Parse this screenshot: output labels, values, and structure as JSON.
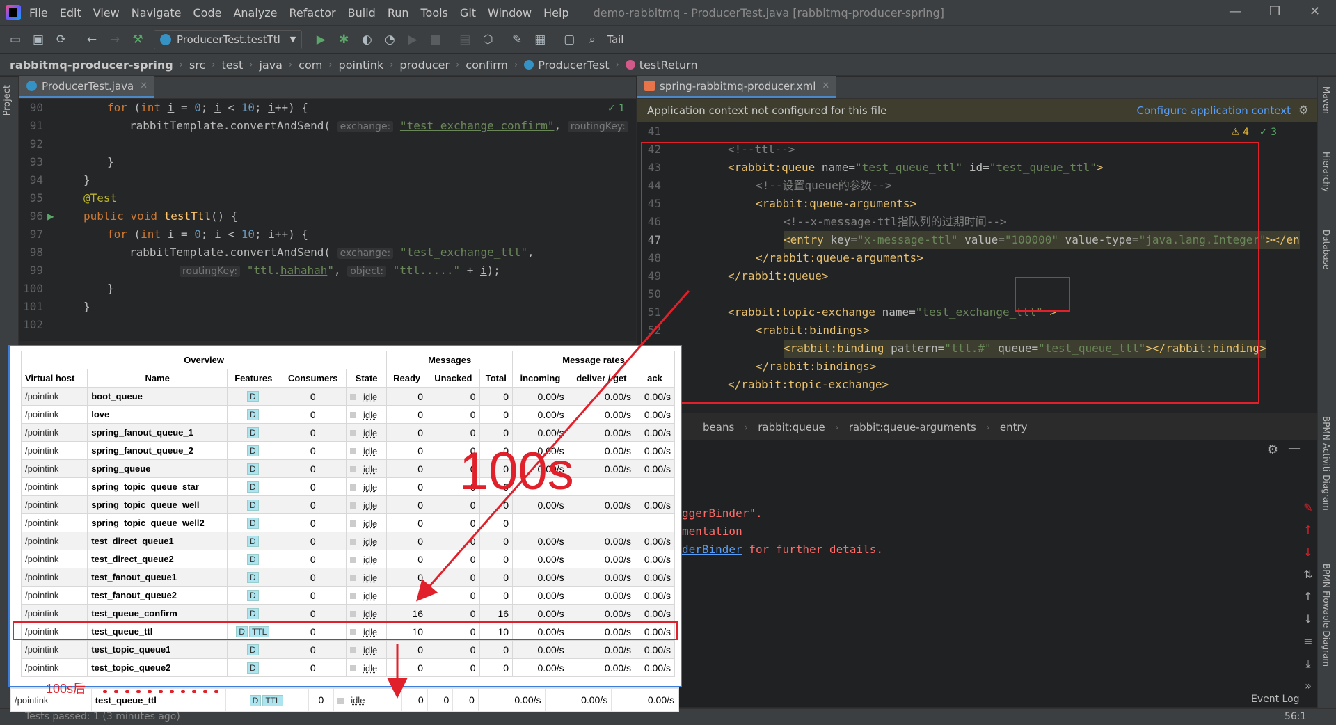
{
  "menubar": {
    "items": [
      "File",
      "Edit",
      "View",
      "Navigate",
      "Code",
      "Analyze",
      "Refactor",
      "Build",
      "Run",
      "Tools",
      "Git",
      "Window",
      "Help"
    ],
    "window_title": "demo-rabbitmq - ProducerTest.java [rabbitmq-producer-spring]"
  },
  "toolbar": {
    "run_config": "ProducerTest.testTtl",
    "tail_label": "Tail"
  },
  "breadcrumb": {
    "project": "rabbitmq-producer-spring",
    "path": [
      "src",
      "test",
      "java",
      "com",
      "pointink",
      "producer",
      "confirm",
      "ProducerTest",
      "testReturn"
    ]
  },
  "left_editor": {
    "tab": "ProducerTest.java",
    "inspection": "✓ 1",
    "project_tool": "Project"
  },
  "right_editor": {
    "tab": "spring-rabbitmq-producer.xml",
    "banner": "Application context not configured for this file",
    "banner_link": "Configure application context",
    "warnings": "⚠ 4",
    "errors": "✓ 3"
  },
  "xml_breadcrumb": [
    "beans",
    "rabbit:queue",
    "rabbit:queue-arguments",
    "entry"
  ],
  "console": {
    "line1": "ggerBinder\".",
    "line2": "mentation",
    "line3_link": "derBinder",
    "line3_rest": " for further details."
  },
  "status": {
    "tests": "Tests passed: 1 (3 minutes ago)",
    "position": "56:1",
    "event_log": "Event Log"
  },
  "right_tools": [
    "Maven",
    "Hierarchy",
    "Database",
    "BPMN-Activiti-Diagram",
    "BPMN-Flowable-Diagram"
  ],
  "annotation": {
    "big": "100s",
    "after": "100s后"
  },
  "rabbit": {
    "group_headers": [
      "Overview",
      "Messages",
      "Message rates"
    ],
    "headers": [
      "Virtual host",
      "Name",
      "Features",
      "Consumers",
      "State",
      "Ready",
      "Unacked",
      "Total",
      "incoming",
      "deliver / get",
      "ack"
    ],
    "rows": [
      [
        "/pointink",
        "boot_queue",
        "D",
        "",
        "0",
        "idle",
        "0",
        "0",
        "0",
        "0.00/s",
        "0.00/s",
        "0.00/s"
      ],
      [
        "/pointink",
        "love",
        "D",
        "",
        "0",
        "idle",
        "0",
        "0",
        "0",
        "0.00/s",
        "0.00/s",
        "0.00/s"
      ],
      [
        "/pointink",
        "spring_fanout_queue_1",
        "D",
        "",
        "0",
        "idle",
        "0",
        "0",
        "0",
        "0.00/s",
        "0.00/s",
        "0.00/s"
      ],
      [
        "/pointink",
        "spring_fanout_queue_2",
        "D",
        "",
        "0",
        "idle",
        "0",
        "0",
        "0",
        "0.00/s",
        "0.00/s",
        "0.00/s"
      ],
      [
        "/pointink",
        "spring_queue",
        "D",
        "",
        "0",
        "idle",
        "0",
        "0",
        "0",
        "0.00/s",
        "0.00/s",
        "0.00/s"
      ],
      [
        "/pointink",
        "spring_topic_queue_star",
        "D",
        "",
        "0",
        "idle",
        "0",
        "0",
        "0",
        "",
        "",
        ""
      ],
      [
        "/pointink",
        "spring_topic_queue_well",
        "D",
        "",
        "0",
        "idle",
        "0",
        "0",
        "0",
        "0.00/s",
        "0.00/s",
        "0.00/s"
      ],
      [
        "/pointink",
        "spring_topic_queue_well2",
        "D",
        "",
        "0",
        "idle",
        "0",
        "0",
        "0",
        "",
        "",
        ""
      ],
      [
        "/pointink",
        "test_direct_queue1",
        "D",
        "",
        "0",
        "idle",
        "0",
        "0",
        "0",
        "0.00/s",
        "0.00/s",
        "0.00/s"
      ],
      [
        "/pointink",
        "test_direct_queue2",
        "D",
        "",
        "0",
        "idle",
        "0",
        "0",
        "0",
        "0.00/s",
        "0.00/s",
        "0.00/s"
      ],
      [
        "/pointink",
        "test_fanout_queue1",
        "D",
        "",
        "0",
        "idle",
        "0",
        "0",
        "0",
        "0.00/s",
        "0.00/s",
        "0.00/s"
      ],
      [
        "/pointink",
        "test_fanout_queue2",
        "D",
        "",
        "0",
        "idle",
        "0",
        "0",
        "0",
        "0.00/s",
        "0.00/s",
        "0.00/s"
      ],
      [
        "/pointink",
        "test_queue_confirm",
        "D",
        "",
        "0",
        "idle",
        "16",
        "0",
        "16",
        "0.00/s",
        "0.00/s",
        "0.00/s"
      ],
      [
        "/pointink",
        "test_queue_ttl",
        "D",
        "TTL",
        "0",
        "idle",
        "10",
        "0",
        "10",
        "0.00/s",
        "0.00/s",
        "0.00/s"
      ],
      [
        "/pointink",
        "test_topic_queue1",
        "D",
        "",
        "0",
        "idle",
        "0",
        "0",
        "0",
        "0.00/s",
        "0.00/s",
        "0.00/s"
      ],
      [
        "/pointink",
        "test_topic_queue2",
        "D",
        "",
        "0",
        "idle",
        "0",
        "0",
        "0",
        "0.00/s",
        "0.00/s",
        "0.00/s"
      ]
    ],
    "after_row": [
      "/pointink",
      "test_queue_ttl",
      "D",
      "TTL",
      "0",
      "idle",
      "0",
      "0",
      "0",
      "0.00/s",
      "0.00/s",
      "0.00/s"
    ]
  },
  "colors": {
    "highlight": "#e0202a",
    "badge": "#ace5f0",
    "ide_bg": "#2b2b2b"
  }
}
